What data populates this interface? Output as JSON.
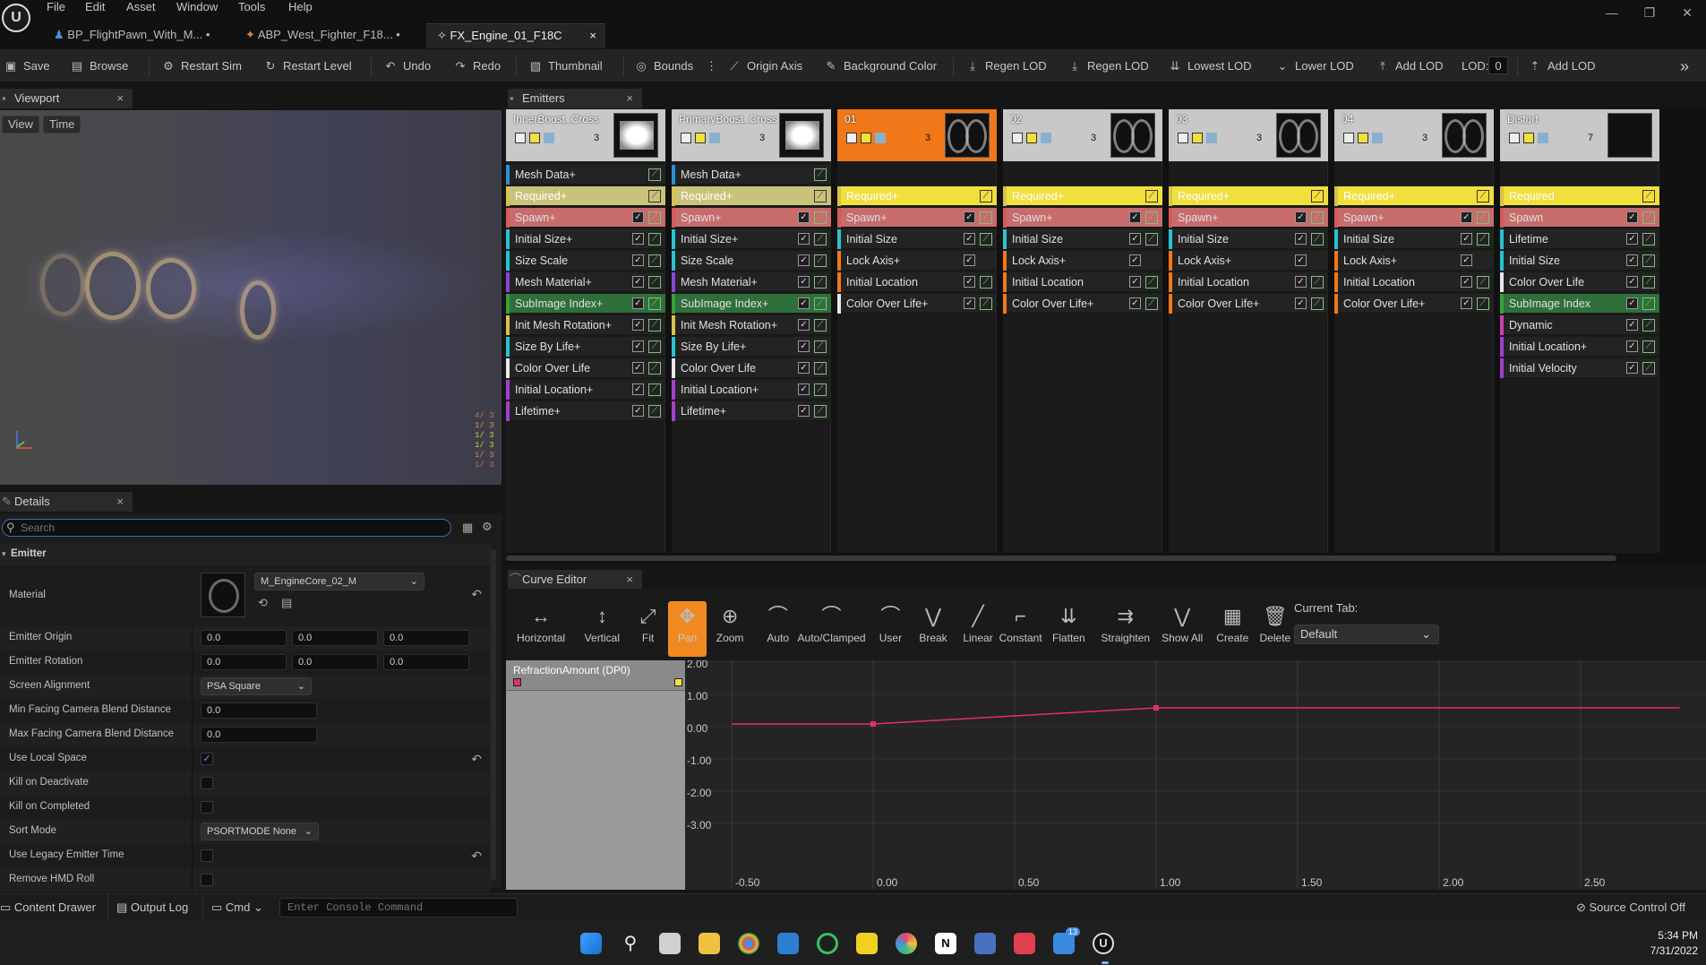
{
  "titlebar": {
    "menus": [
      "File",
      "Edit",
      "Asset",
      "Window",
      "Tools",
      "Help"
    ],
    "tabs": [
      {
        "label": "BP_FlightPawn_With_M...",
        "dirty": "•"
      },
      {
        "label": "ABP_West_Fighter_F18...",
        "dirty": "•"
      },
      {
        "label": "FX_Engine_01_F18C",
        "close": "×"
      }
    ]
  },
  "toolbar": {
    "save": "Save",
    "browse": "Browse",
    "restart_sim": "Restart Sim",
    "restart_level": "Restart Level",
    "undo": "Undo",
    "redo": "Redo",
    "thumbnail": "Thumbnail",
    "bounds": "Bounds",
    "origin_axis": "Origin Axis",
    "background_color": "Background Color",
    "regen_lod_1": "Regen LOD",
    "regen_lod_2": "Regen LOD",
    "lowest_lod": "Lowest LOD",
    "lower_lod": "Lower LOD",
    "add_lod_1": "Add LOD",
    "lod_label": "LOD:",
    "lod_value": "0",
    "add_lod_2": "Add LOD"
  },
  "viewport": {
    "tab": "Viewport",
    "view_btn": "View",
    "time_btn": "Time",
    "stats": [
      "4/ 3",
      "1/ 3",
      "1/ 3",
      "1/ 3",
      "1/ 3",
      "1/ 3"
    ]
  },
  "details": {
    "tab": "Details",
    "search_placeholder": "Search",
    "section": "Emitter",
    "material_label": "Material",
    "material_value": "M_EngineCore_02_M",
    "rows": [
      {
        "label": "Emitter Origin",
        "values": [
          "0.0",
          "0.0",
          "0.0"
        ]
      },
      {
        "label": "Emitter Rotation",
        "values": [
          "0.0",
          "0.0",
          "0.0"
        ]
      },
      {
        "label": "Screen Alignment",
        "combo": "PSA Square"
      },
      {
        "label": "Min Facing Camera Blend Distance",
        "value": "0.0"
      },
      {
        "label": "Max Facing Camera Blend Distance",
        "value": "0.0"
      },
      {
        "label": "Use Local Space",
        "checked": true
      },
      {
        "label": "Kill on Deactivate",
        "checked": false
      },
      {
        "label": "Kill on Completed",
        "checked": false
      },
      {
        "label": "Sort Mode",
        "combo": "PSORTMODE None"
      },
      {
        "label": "Use Legacy Emitter Time",
        "checked": false
      },
      {
        "label": "Remove HMD Roll",
        "checked": false
      }
    ]
  },
  "emitters": {
    "tab": "Emitters",
    "columns": [
      {
        "name": "InnerBoost_Cross",
        "count": "3",
        "head_color": "#c8c8c8",
        "modules": [
          {
            "label": "Mesh Data+",
            "bar": "#2e8fd6",
            "bg": "#232323",
            "c1": false
          },
          {
            "label": "Required+",
            "bar": "#d8c24a",
            "bg": "#c9c27a",
            "c1": false,
            "dark": true
          },
          {
            "label": "Spawn+",
            "bar": "#d65a5a",
            "bg": "#c76b6b",
            "c1": true
          },
          {
            "label": "Initial Size+",
            "bar": "#27c4d0",
            "bg": "#232323",
            "c1": true
          },
          {
            "label": "Size Scale",
            "bar": "#27c4d0",
            "bg": "#232323",
            "c1": true
          },
          {
            "label": "Mesh Material+",
            "bar": "#8a45d8",
            "bg": "#232323",
            "c1": true
          },
          {
            "label": "SubImage Index+",
            "bar": "#3aa03a",
            "bg": "#2e6f3a",
            "c1": true
          },
          {
            "label": "Init Mesh Rotation+",
            "bar": "#d8c24a",
            "bg": "#232323",
            "c1": true
          },
          {
            "label": "Size By Life+",
            "bar": "#27c4d0",
            "bg": "#232323",
            "c1": true
          },
          {
            "label": "Color Over Life",
            "bar": "#e8e8e8",
            "bg": "#232323",
            "c1": true
          },
          {
            "label": "Initial Location+",
            "bar": "#a33fd0",
            "bg": "#232323",
            "c1": true
          },
          {
            "label": "Lifetime+",
            "bar": "#a33fd0",
            "bg": "#232323",
            "c1": true
          }
        ]
      },
      {
        "name": "PrimaryBoost_Cross",
        "count": "3",
        "head_color": "#c8c8c8",
        "modules": [
          {
            "label": "Mesh Data+",
            "bar": "#2e8fd6",
            "bg": "#232323",
            "c1": false
          },
          {
            "label": "Required+",
            "bar": "#d8c24a",
            "bg": "#c9c27a",
            "c1": false,
            "dark": true
          },
          {
            "label": "Spawn+",
            "bar": "#d65a5a",
            "bg": "#c76b6b",
            "c1": true
          },
          {
            "label": "Initial Size+",
            "bar": "#27c4d0",
            "bg": "#232323",
            "c1": true
          },
          {
            "label": "Size Scale",
            "bar": "#27c4d0",
            "bg": "#232323",
            "c1": true
          },
          {
            "label": "Mesh Material+",
            "bar": "#8a45d8",
            "bg": "#232323",
            "c1": true
          },
          {
            "label": "SubImage Index+",
            "bar": "#3aa03a",
            "bg": "#2e6f3a",
            "c1": true
          },
          {
            "label": "Init Mesh Rotation+",
            "bar": "#d8c24a",
            "bg": "#232323",
            "c1": true
          },
          {
            "label": "Size By Life+",
            "bar": "#27c4d0",
            "bg": "#232323",
            "c1": true
          },
          {
            "label": "Color Over Life",
            "bar": "#e8e8e8",
            "bg": "#232323",
            "c1": true
          },
          {
            "label": "Initial Location+",
            "bar": "#a33fd0",
            "bg": "#232323",
            "c1": true
          },
          {
            "label": "Lifetime+",
            "bar": "#a33fd0",
            "bg": "#232323",
            "c1": true
          }
        ]
      },
      {
        "name": "01",
        "count": "3",
        "head_color": "#f07818",
        "modules": [
          {
            "label": "Required+",
            "bar": "#d8c24a",
            "bg": "#f1df3d",
            "c1": false,
            "dark": true
          },
          {
            "label": "Spawn+",
            "bar": "#d65a5a",
            "bg": "#c76b6b",
            "c1": true
          },
          {
            "label": "Initial Size",
            "bar": "#27c4d0",
            "bg": "#232323",
            "c1": true
          },
          {
            "label": "Lock Axis+",
            "bar": "#f07818",
            "bg": "#232323",
            "c1": true,
            "no_curve": true
          },
          {
            "label": "Initial Location",
            "bar": "#f07818",
            "bg": "#232323",
            "c1": true
          },
          {
            "label": "Color Over Life+",
            "bar": "#e8e8e8",
            "bg": "#232323",
            "c1": true
          }
        ]
      },
      {
        "name": "02",
        "count": "3",
        "head_color": "#c8c8c8",
        "modules": [
          {
            "label": "Required+",
            "bar": "#d8c24a",
            "bg": "#f1df3d",
            "c1": false,
            "dark": true
          },
          {
            "label": "Spawn+",
            "bar": "#d65a5a",
            "bg": "#c76b6b",
            "c1": true
          },
          {
            "label": "Initial Size",
            "bar": "#27c4d0",
            "bg": "#232323",
            "c1": true
          },
          {
            "label": "Lock Axis+",
            "bar": "#f07818",
            "bg": "#232323",
            "c1": true,
            "no_curve": true
          },
          {
            "label": "Initial Location",
            "bar": "#f07818",
            "bg": "#232323",
            "c1": true
          },
          {
            "label": "Color Over Life+",
            "bar": "#f07818",
            "bg": "#232323",
            "c1": true
          }
        ]
      },
      {
        "name": "03",
        "count": "3",
        "head_color": "#c8c8c8",
        "modules": [
          {
            "label": "Required+",
            "bar": "#d8c24a",
            "bg": "#f1df3d",
            "c1": false,
            "dark": true
          },
          {
            "label": "Spawn+",
            "bar": "#d65a5a",
            "bg": "#c76b6b",
            "c1": true
          },
          {
            "label": "Initial Size",
            "bar": "#27c4d0",
            "bg": "#232323",
            "c1": true
          },
          {
            "label": "Lock Axis+",
            "bar": "#f07818",
            "bg": "#232323",
            "c1": true,
            "no_curve": true
          },
          {
            "label": "Initial Location",
            "bar": "#f07818",
            "bg": "#232323",
            "c1": true
          },
          {
            "label": "Color Over Life+",
            "bar": "#f07818",
            "bg": "#232323",
            "c1": true
          }
        ]
      },
      {
        "name": "04",
        "count": "3",
        "head_color": "#c8c8c8",
        "modules": [
          {
            "label": "Required+",
            "bar": "#d8c24a",
            "bg": "#f1df3d",
            "c1": false,
            "dark": true
          },
          {
            "label": "Spawn+",
            "bar": "#d65a5a",
            "bg": "#c76b6b",
            "c1": true
          },
          {
            "label": "Initial Size",
            "bar": "#27c4d0",
            "bg": "#232323",
            "c1": true
          },
          {
            "label": "Lock Axis+",
            "bar": "#f07818",
            "bg": "#232323",
            "c1": true,
            "no_curve": true
          },
          {
            "label": "Initial Location",
            "bar": "#f07818",
            "bg": "#232323",
            "c1": true
          },
          {
            "label": "Color Over Life+",
            "bar": "#f07818",
            "bg": "#232323",
            "c1": true
          }
        ]
      },
      {
        "name": "Distort",
        "count": "7",
        "head_color": "#c8c8c8",
        "modules": [
          {
            "label": "Required",
            "bar": "#d8c24a",
            "bg": "#f1df3d",
            "c1": false,
            "dark": true
          },
          {
            "label": "Spawn",
            "bar": "#d65a5a",
            "bg": "#c76b6b",
            "c1": true
          },
          {
            "label": "Lifetime",
            "bar": "#27c4d0",
            "bg": "#232323",
            "c1": true
          },
          {
            "label": "Initial Size",
            "bar": "#27c4d0",
            "bg": "#232323",
            "c1": true
          },
          {
            "label": "Color Over Life",
            "bar": "#e8e8e8",
            "bg": "#232323",
            "c1": true
          },
          {
            "label": "SubImage Index",
            "bar": "#3aa03a",
            "bg": "#2e6f3a",
            "c1": true
          },
          {
            "label": "Dynamic",
            "bar": "#d03fb0",
            "bg": "#232323",
            "c1": true
          },
          {
            "label": "Initial Location+",
            "bar": "#a33fd0",
            "bg": "#232323",
            "c1": true
          },
          {
            "label": "Initial Velocity",
            "bar": "#a33fd0",
            "bg": "#232323",
            "c1": true
          }
        ]
      }
    ]
  },
  "curve_editor": {
    "tab": "Curve Editor",
    "buttons": [
      {
        "label": "Horizontal",
        "icon": "↔"
      },
      {
        "label": "Vertical",
        "icon": "↕"
      },
      {
        "label": "Fit",
        "icon": "⤢"
      },
      {
        "label": "Pan",
        "icon": "✥"
      },
      {
        "label": "Zoom",
        "icon": "⊕"
      },
      {
        "label": "Auto",
        "icon": "⌒"
      },
      {
        "label": "Auto/Clamped",
        "icon": "⌒"
      },
      {
        "label": "User",
        "icon": "⌒"
      },
      {
        "label": "Break",
        "icon": "⋁"
      },
      {
        "label": "Linear",
        "icon": "╱"
      },
      {
        "label": "Constant",
        "icon": "⌐"
      },
      {
        "label": "Flatten",
        "icon": "⇊"
      },
      {
        "label": "Straighten",
        "icon": "⇉"
      },
      {
        "label": "Show All",
        "icon": "⋁"
      },
      {
        "label": "Create",
        "icon": "▦"
      },
      {
        "label": "Delete",
        "icon": "🗑"
      }
    ],
    "current_tab_label": "Current Tab:",
    "current_tab_value": "Default",
    "track": "RefractionAmount (DP0)",
    "y_labels": [
      "2.00",
      "1.00",
      "0.00",
      "-1.00",
      "-2.00",
      "-3.00"
    ],
    "x_labels": [
      "-0.50",
      "0.00",
      "0.50",
      "1.00",
      "1.50",
      "2.00",
      "2.50"
    ],
    "curve_points": [
      [
        -0.5,
        0.25
      ],
      [
        0.0,
        0.25
      ],
      [
        1.0,
        0.75
      ],
      [
        2.85,
        0.75
      ]
    ],
    "curve_color": "#e0306a"
  },
  "status": {
    "content_drawer": "Content Drawer",
    "output_log": "Output Log",
    "cmd": "Cmd",
    "console_placeholder": "Enter Console Command",
    "source_control": "Source Control Off"
  },
  "taskbar": {
    "time": "5:34 PM",
    "date": "7/31/2022",
    "badge": "13"
  }
}
